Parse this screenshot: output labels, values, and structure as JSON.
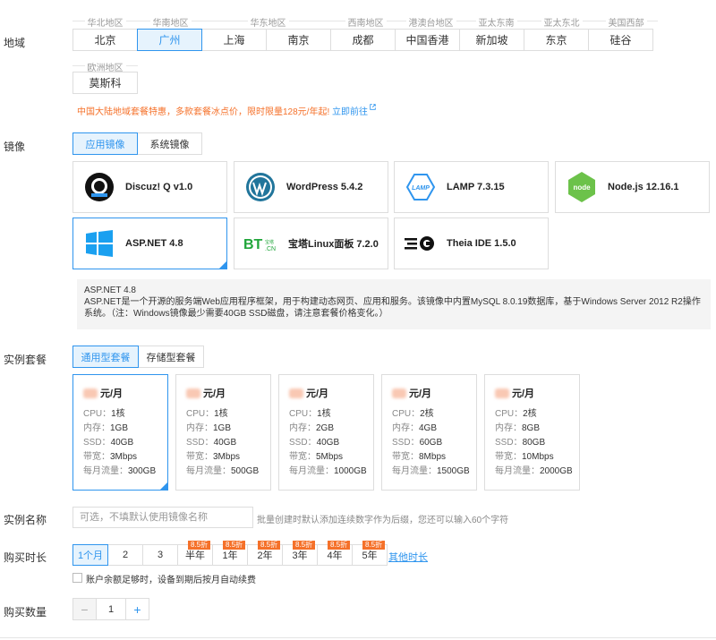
{
  "region": {
    "label": "地域",
    "groups": [
      "华北地区",
      "华南地区",
      "华东地区",
      "西南地区",
      "港澳台地区",
      "亚太东南",
      "亚太东北",
      "美国西部"
    ],
    "items": [
      "北京",
      "广州",
      "上海",
      "南京",
      "成都",
      "中国香港",
      "新加坡",
      "东京",
      "硅谷"
    ],
    "selected": "广州",
    "europe_group": "欧洲地区",
    "europe_item": "莫斯科",
    "promo_text": "中国大陆地域套餐特惠，多款套餐冰点价，限时限量128元/年起!",
    "promo_link": "立即前往"
  },
  "image": {
    "label": "镜像",
    "tabs": [
      "应用镜像",
      "系统镜像"
    ],
    "selected_tab": "应用镜像",
    "cards": [
      {
        "name": "Discuz! Q v1.0",
        "icon": "discuz-icon"
      },
      {
        "name": "WordPress 5.4.2",
        "icon": "wordpress-icon"
      },
      {
        "name": "LAMP 7.3.15",
        "icon": "lamp-icon"
      },
      {
        "name": "Node.js 12.16.1",
        "icon": "nodejs-icon"
      },
      {
        "name": "ASP.NET 4.8",
        "icon": "windows-icon"
      },
      {
        "name": "宝塔Linux面板 7.2.0",
        "icon": "bt-icon"
      },
      {
        "name": "Theia IDE 1.5.0",
        "icon": "theia-icon"
      }
    ],
    "selected_card": "ASP.NET 4.8",
    "desc_title": "ASP.NET 4.8",
    "desc_text": "ASP.NET是一个开源的服务端Web应用程序框架，用于构建动态网页、应用和服务。该镜像中内置MySQL 8.0.19数据库，基于Windows Server 2012 R2操作系统。（注：Windows镜像最少需要40GB SSD磁盘，请注意套餐价格变化。）"
  },
  "plan": {
    "label": "实例套餐",
    "tabs": [
      "通用型套餐",
      "存储型套餐"
    ],
    "selected_tab": "通用型套餐",
    "unit": "元/月",
    "keys": {
      "cpu": "CPU：",
      "mem": "内存：",
      "ssd": "SSD：",
      "bw": "带宽：",
      "traffic": "每月流量："
    },
    "items": [
      {
        "cpu": "1核",
        "mem": "1GB",
        "ssd": "40GB",
        "bw": "3Mbps",
        "traffic": "300GB"
      },
      {
        "cpu": "1核",
        "mem": "1GB",
        "ssd": "40GB",
        "bw": "3Mbps",
        "traffic": "500GB"
      },
      {
        "cpu": "1核",
        "mem": "2GB",
        "ssd": "40GB",
        "bw": "5Mbps",
        "traffic": "1000GB"
      },
      {
        "cpu": "2核",
        "mem": "4GB",
        "ssd": "60GB",
        "bw": "8Mbps",
        "traffic": "1500GB"
      },
      {
        "cpu": "2核",
        "mem": "8GB",
        "ssd": "80GB",
        "bw": "10Mbps",
        "traffic": "2000GB"
      }
    ],
    "selected_index": 0
  },
  "instance_name": {
    "label": "实例名称",
    "placeholder": "可选，不填默认使用镜像名称",
    "hint": "批量创建时默认添加连续数字作为后缀，您还可以输入60个字符"
  },
  "duration": {
    "label": "购买时长",
    "options": [
      "1个月",
      "2",
      "3",
      "半年",
      "1年",
      "2年",
      "3年",
      "4年",
      "5年"
    ],
    "selected": "1个月",
    "discount_label": "8.5折",
    "more": "其他时长",
    "auto_renew": "账户余额足够时，设备到期后按月自动续费"
  },
  "quantity": {
    "label": "购买数量",
    "value": "1",
    "minus": "−",
    "plus": "+"
  },
  "colors": {
    "accent": "#2f95ee",
    "promo": "#f5712a"
  }
}
